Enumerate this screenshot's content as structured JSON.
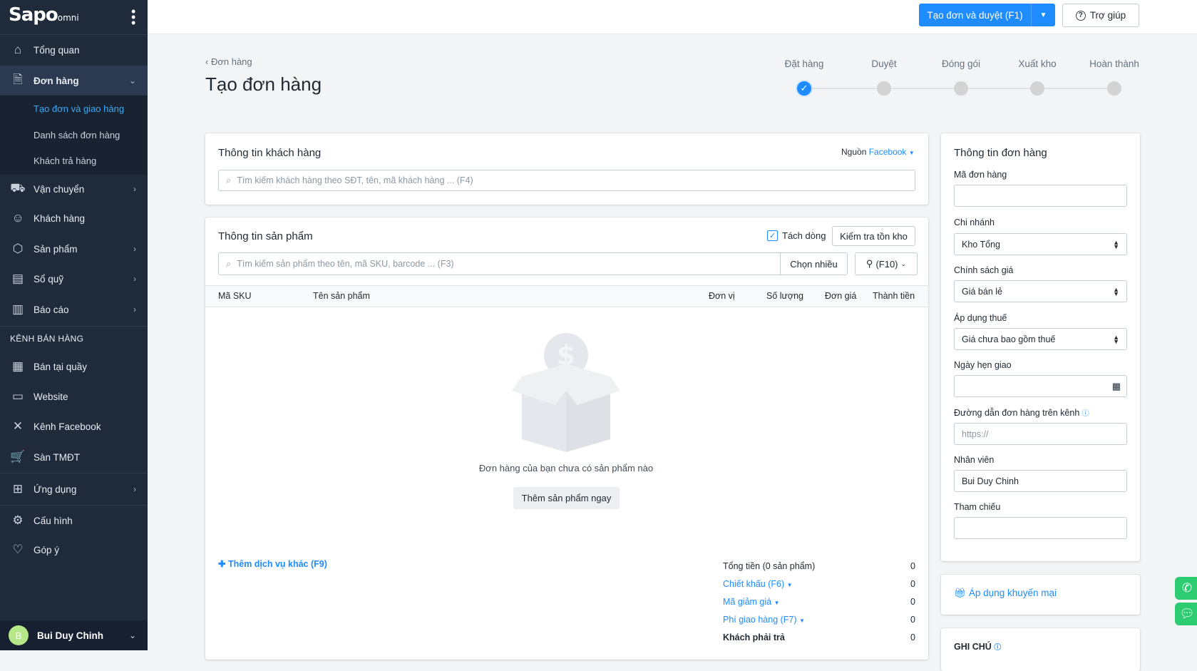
{
  "sidebar": {
    "logo": "Sapo",
    "logo_suffix": "omni",
    "items": [
      {
        "label": "Tổng quan",
        "icon": "home-icon"
      },
      {
        "label": "Đơn hàng",
        "icon": "order-icon"
      },
      {
        "label": "Vận chuyển",
        "icon": "truck-icon"
      },
      {
        "label": "Khách hàng",
        "icon": "user-icon"
      },
      {
        "label": "Sản phẩm",
        "icon": "box-icon"
      },
      {
        "label": "Sổ quỹ",
        "icon": "cash-icon"
      },
      {
        "label": "Báo cáo",
        "icon": "chart-icon"
      }
    ],
    "sub_items": [
      "Tạo đơn và giao hàng",
      "Danh sách đơn hàng",
      "Khách trả hàng"
    ],
    "section_label": "KÊNH BÁN HÀNG",
    "channels": [
      {
        "label": "Bán tại quầy",
        "icon": "pos-icon"
      },
      {
        "label": "Website",
        "icon": "website-icon"
      },
      {
        "label": "Kênh Facebook",
        "icon": "network-icon"
      },
      {
        "label": "Sàn TMĐT",
        "icon": "cart-icon"
      }
    ],
    "apps": "Ứng dụng",
    "settings": "Cấu hình",
    "feedback": "Góp ý",
    "user": {
      "initial": "B",
      "name": "Bui Duy Chinh"
    }
  },
  "topbar": {
    "primary": "Tạo đơn và duyệt (F1)",
    "help": "Trợ giúp"
  },
  "page": {
    "breadcrumb": "Đơn hàng",
    "title": "Tạo đơn hàng"
  },
  "steps": [
    "Đặt hàng",
    "Duyệt",
    "Đóng gói",
    "Xuất kho",
    "Hoàn thành"
  ],
  "customer": {
    "title": "Thông tin khách hàng",
    "source_label": "Nguồn",
    "source_value": "Facebook",
    "search_placeholder": "Tìm kiếm khách hàng theo SĐT, tên, mã khách hàng ... (F4)"
  },
  "products": {
    "title": "Thông tin sản phẩm",
    "split_label": "Tách dòng",
    "split_checked": true,
    "check_stock": "Kiểm tra tồn kho",
    "search_placeholder": "Tìm kiếm sản phẩm theo tên, mã SKU, barcode ... (F3)",
    "multi": "Chọn nhiều",
    "filter": "(F10)",
    "columns": [
      "Mã SKU",
      "Tên sản phẩm",
      "Đơn vị",
      "Số lượng",
      "Đơn giá",
      "Thành tiền"
    ],
    "empty_text": "Đơn hàng của bạn chưa có sản phẩm nào",
    "add_now": "Thêm sản phẩm ngay",
    "add_service": "Thêm dịch vụ khác (F9)"
  },
  "summary": [
    {
      "label": "Tổng tiền (0 sản phẩm)",
      "value": "0"
    },
    {
      "label": "Chiết khấu (F6)",
      "value": "0"
    },
    {
      "label": "Mã giảm giá",
      "value": "0"
    },
    {
      "label": "Phí giao hàng (F7)",
      "value": "0"
    },
    {
      "label": "Khách phải trả",
      "value": "0"
    }
  ],
  "order": {
    "title": "Thông tin đơn hàng",
    "code_label": "Mã đơn hàng",
    "code_value": "",
    "branch_label": "Chi nhánh",
    "branch_value": "Kho Tổng",
    "price_label": "Chính sách giá",
    "price_value": "Giá bán lẻ",
    "tax_label": "Áp dụng thuế",
    "tax_value": "Giá chưa bao gồm thuế",
    "date_label": "Ngày hẹn giao",
    "link_label": "Đường dẫn đơn hàng trên kênh",
    "link_placeholder": "https://",
    "staff_label": "Nhân viên",
    "staff_value": "Bui Duy Chinh",
    "ref_label": "Tham chiếu"
  },
  "promo": "Áp dụng khuyến mại",
  "note_title": "GHI CHÚ",
  "colors": {
    "sidebar": "#1f2a3b",
    "accent": "#1e8bff",
    "float": "#2ecc71"
  }
}
